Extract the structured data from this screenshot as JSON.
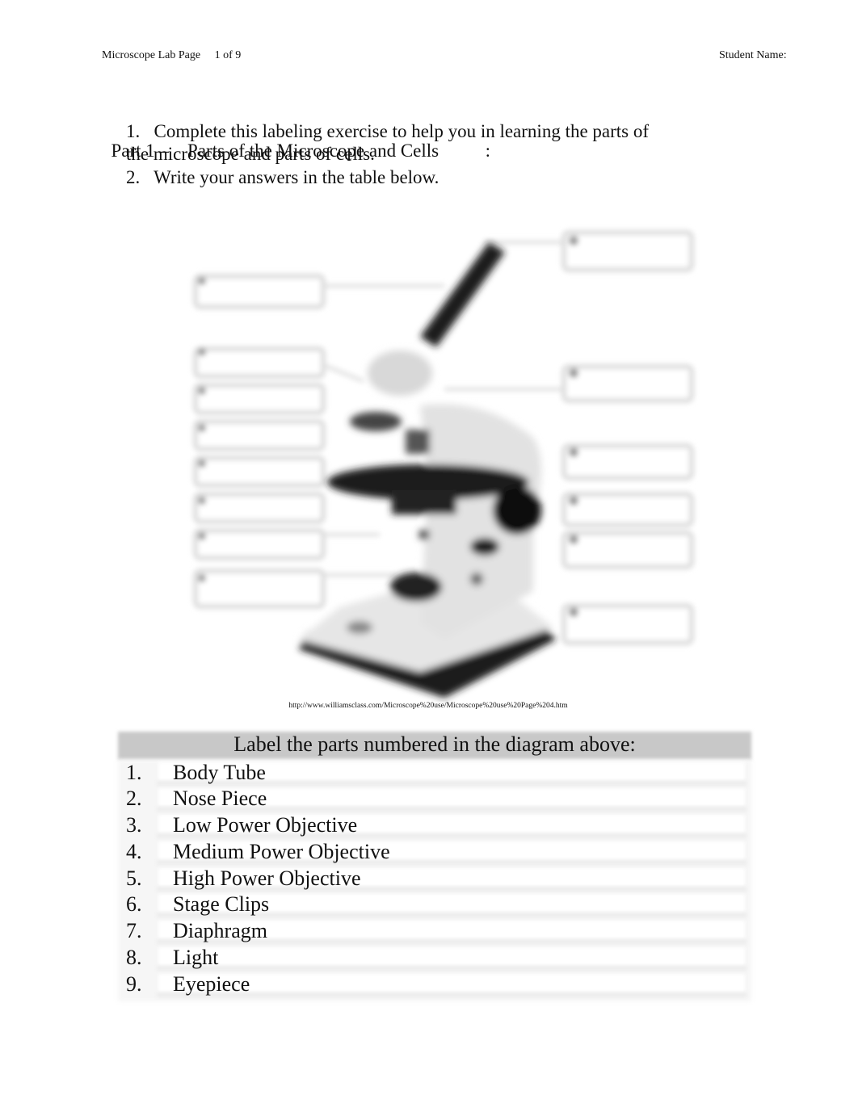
{
  "header": {
    "title": "Microscope Lab Page",
    "page": "1 of 9",
    "student_label": "Student Name:"
  },
  "part": {
    "title": "Part 1 –    Parts of the Microscope and Cells          :",
    "instructions": [
      "1.   Complete this labeling exercise to help you in learning the parts of",
      "the microscope and parts of cells.",
      "2.   Write your answers in the table below."
    ]
  },
  "diagram": {
    "description": "Microscope diagram with numbered blank label boxes (blurred)",
    "caption": "http://www.williamsclass.com/Microscope%20use/Microscope%20use%20Page%204.htm"
  },
  "answer_table": {
    "header": "Label the parts numbered in the diagram above:",
    "rows": [
      {
        "num": "1.",
        "answer": "Body Tube"
      },
      {
        "num": "2.",
        "answer": "Nose Piece"
      },
      {
        "num": "3.",
        "answer": "Low Power Objective"
      },
      {
        "num": "4.",
        "answer": "Medium Power Objective"
      },
      {
        "num": "5.",
        "answer": "High Power Objective"
      },
      {
        "num": "6.",
        "answer": "Stage Clips"
      },
      {
        "num": "7.",
        "answer": "Diaphragm"
      },
      {
        "num": "8.",
        "answer": "Light"
      },
      {
        "num": "9.",
        "answer": "Eyepiece"
      }
    ]
  }
}
